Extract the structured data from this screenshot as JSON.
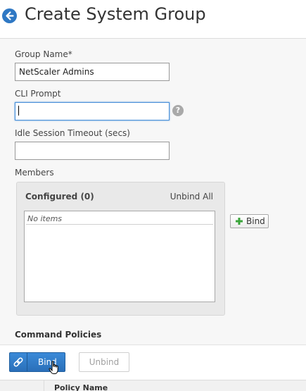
{
  "header": {
    "title": "Create System Group"
  },
  "form": {
    "group_name_label": "Group Name*",
    "group_name_value": "NetScaler Admins",
    "cli_prompt_label": "CLI Prompt",
    "cli_prompt_value": "",
    "idle_timeout_label": "Idle Session Timeout (secs)",
    "idle_timeout_value": "",
    "help_glyph": "?"
  },
  "members": {
    "label": "Members",
    "configured_label": "Configured (0)",
    "unbind_all_label": "Unbind All",
    "empty_text": "No items",
    "bind_label": "Bind"
  },
  "command_policies": {
    "title": "Command Policies",
    "bind_label": "Bind",
    "unbind_label": "Unbind",
    "table_columns": [
      "Policy Name"
    ]
  },
  "colors": {
    "accent": "#2f78c4",
    "primary_button": "#2a6fb9",
    "plus_icon": "#3aa53a"
  },
  "icons": {
    "back": "back-arrow-icon",
    "help": "question-icon",
    "plus": "plus-icon",
    "link": "link-icon",
    "cursor": "hand-cursor-icon"
  }
}
